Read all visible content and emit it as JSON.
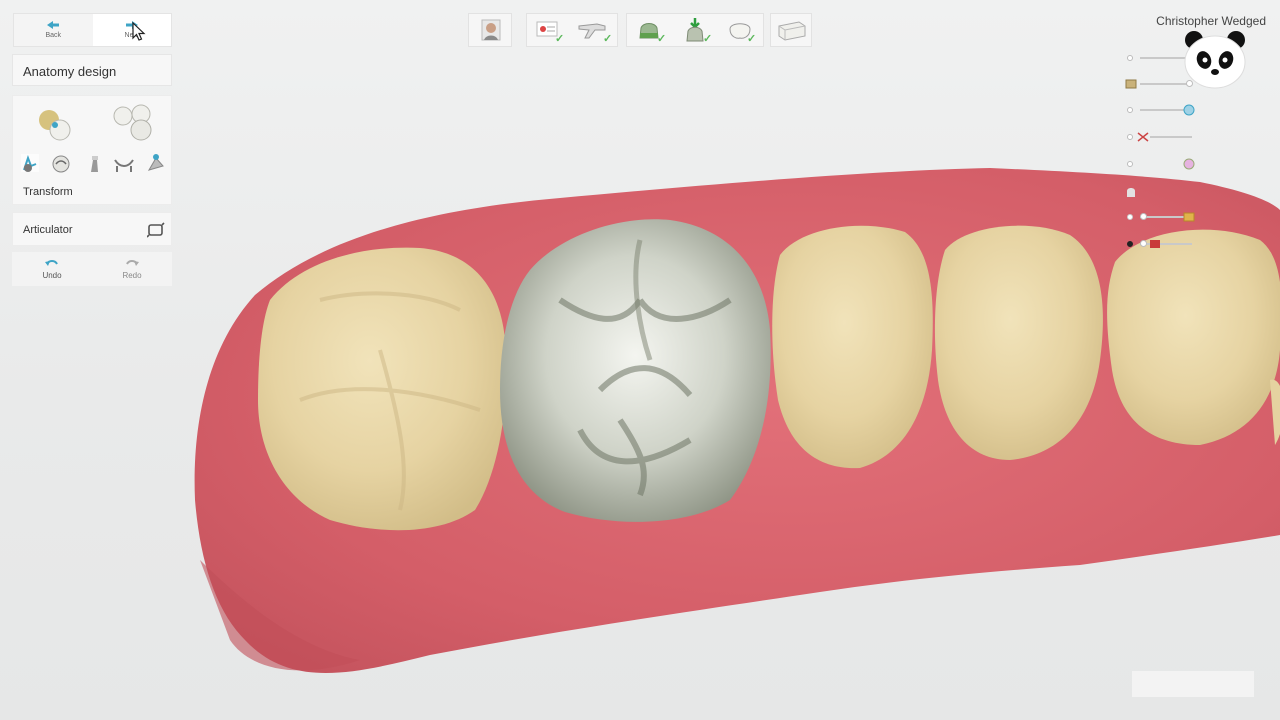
{
  "nav": {
    "back_label": "Back",
    "next_label": "Next"
  },
  "panel": {
    "section_title": "Anatomy design",
    "transform_label": "Transform",
    "articulator_label": "Articulator",
    "undo_label": "Undo",
    "redo_label": "Redo"
  },
  "tools": [
    "anatomy-single-tooth-icon",
    "anatomy-multiple-teeth-icon",
    "morph-icon",
    "smooth-icon",
    "add-material-icon",
    "bridge-icon",
    "scraper-icon"
  ],
  "workflow": {
    "steps": [
      "patient",
      "prescription",
      "scan",
      "margin",
      "insertion-axis",
      "anatomy",
      "milling"
    ]
  },
  "user": {
    "name": "Christopher Wedged"
  },
  "colors": {
    "gingiva": "#d9656d",
    "tooth": "#e7d6a6",
    "crown": "#c8ccc0",
    "accent": "#3ea4c6",
    "check": "#5cb85c"
  }
}
